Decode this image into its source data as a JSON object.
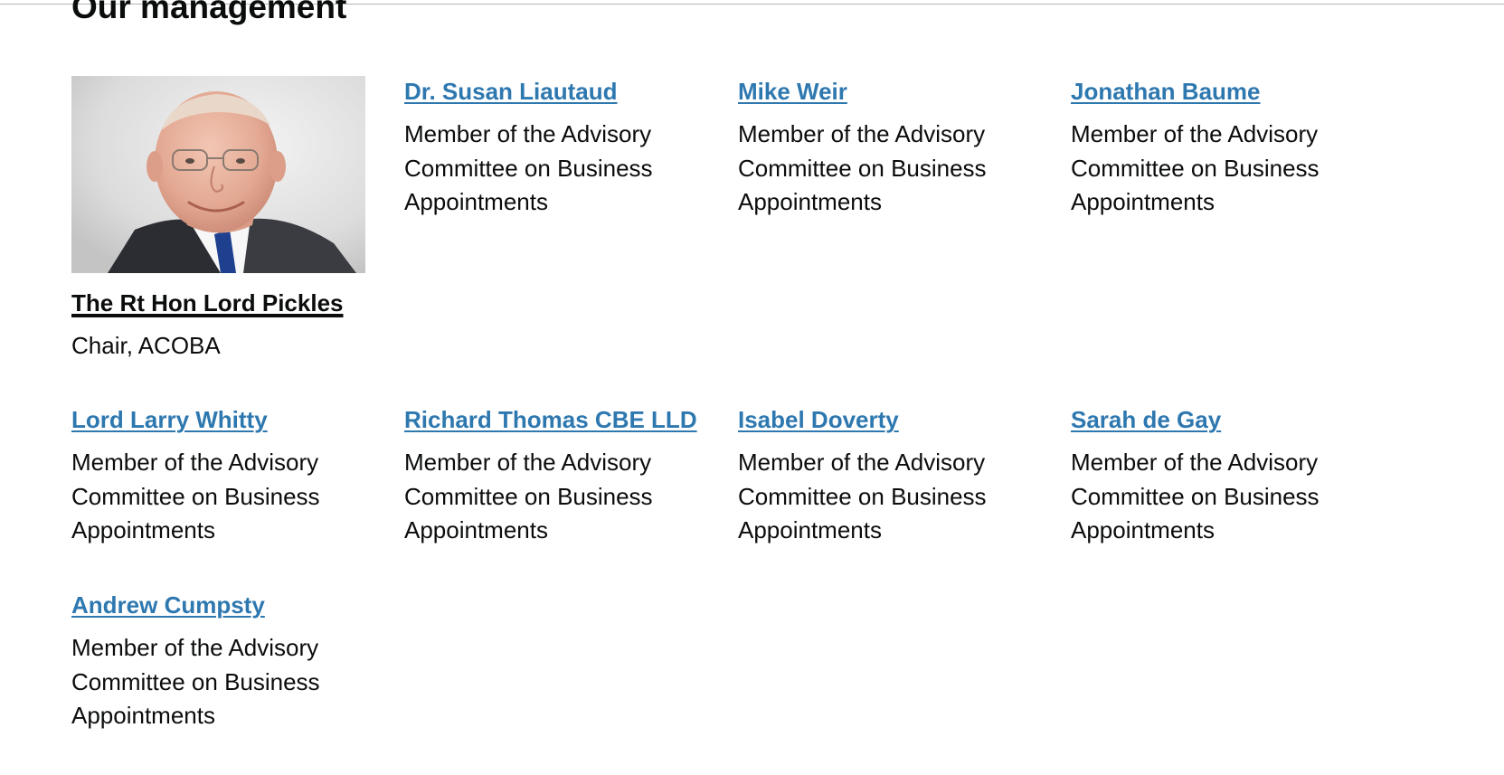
{
  "section": {
    "title": "Our management"
  },
  "people": [
    {
      "name": "The Rt Hon Lord Pickles",
      "role": "Chair, ACOBA"
    },
    {
      "name": "Dr. Susan Liautaud",
      "role": "Member of the Advisory Committee on Business Appointments"
    },
    {
      "name": "Mike Weir",
      "role": "Member of the Advisory Committee on Business Appointments"
    },
    {
      "name": "Jonathan Baume",
      "role": "Member of the Advisory Committee on Business Appointments"
    },
    {
      "name": "Lord Larry Whitty",
      "role": "Member of the Advisory Committee on Business Appointments"
    },
    {
      "name": "Richard Thomas CBE LLD",
      "role": "Member of the Advisory Committee on Business Appointments"
    },
    {
      "name": "Isabel Doverty",
      "role": "Member of the Advisory Committee on Business Appointments"
    },
    {
      "name": "Sarah de Gay",
      "role": "Member of the Advisory Committee on Business Appointments"
    },
    {
      "name": "Andrew Cumpsty",
      "role": "Member of the Advisory Committee on Business Appointments"
    }
  ],
  "colors": {
    "link": "#2e78b0",
    "text": "#0b0c0c",
    "background": "#ffffff"
  }
}
